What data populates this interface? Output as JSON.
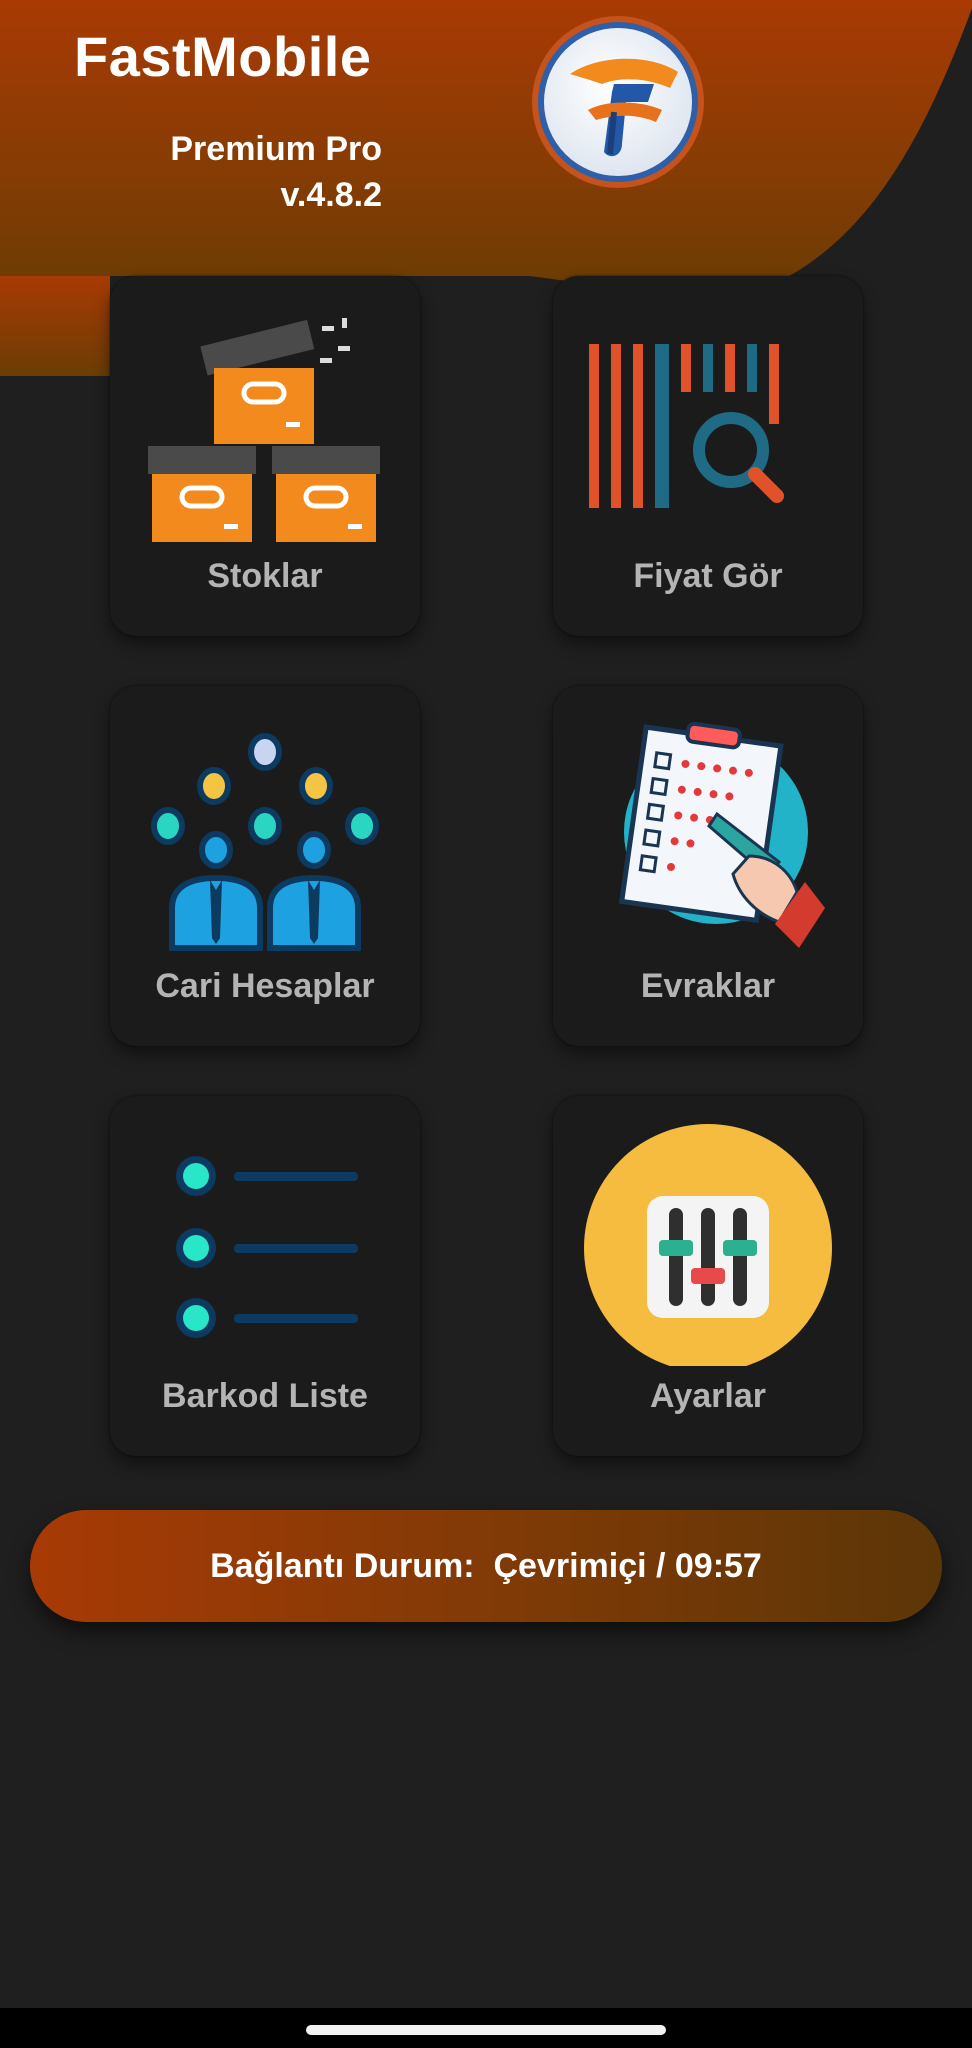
{
  "header": {
    "app_title": "FastMobile",
    "edition": "Premium Pro",
    "version": "v.4.8.2",
    "logo_icon": "fastmobile-f-logo-icon",
    "gradient_colors": [
      "#a93a04",
      "#6a3d04"
    ]
  },
  "tiles": [
    {
      "label": "Stoklar",
      "icon": "boxes-icon"
    },
    {
      "label": "Fiyat Gör",
      "icon": "barcode-search-icon"
    },
    {
      "label": "Cari Hesaplar",
      "icon": "people-group-icon"
    },
    {
      "label": "Evraklar",
      "icon": "checklist-clipboard-icon"
    },
    {
      "label": "Barkod Liste",
      "icon": "bullet-list-icon"
    },
    {
      "label": "Ayarlar",
      "icon": "sliders-settings-icon"
    }
  ],
  "status": {
    "text": "Bağlantı Durum:  Çevrimiçi / 09:57"
  },
  "colors": {
    "background": "#1f1f1f",
    "tile": "#1b1b1b",
    "tile_label": "#b4b4b4",
    "accent_orange": "#f28a1e"
  }
}
